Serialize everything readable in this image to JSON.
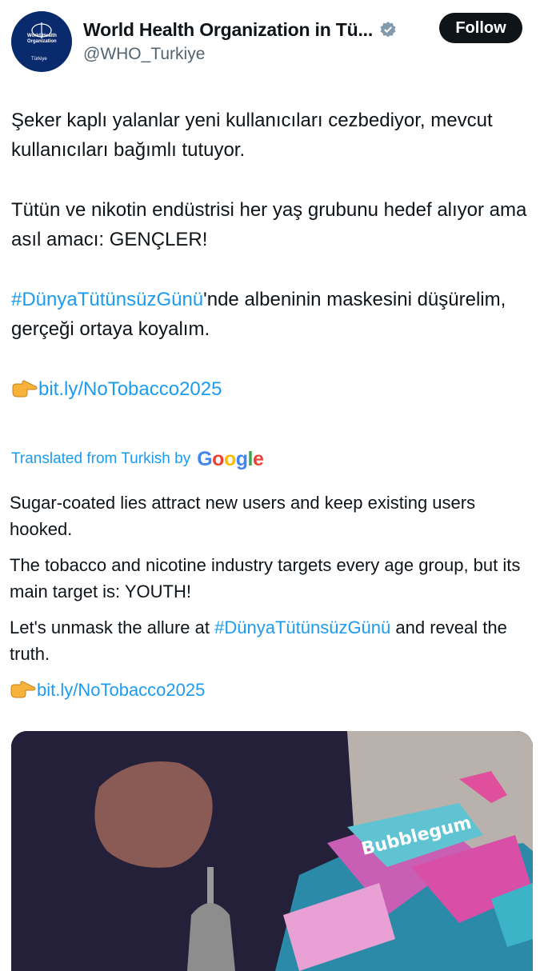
{
  "header": {
    "avatar_text_1": "World Health Organization",
    "avatar_text_2": "Türkiye",
    "display_name": "World Health Organization in Tü...",
    "handle": "@WHO_Turkiye",
    "follow_label": "Follow"
  },
  "tweet": {
    "line1": "Şeker kaplı yalanlar yeni kullanıcıları cezbediyor, mevcut kullanıcıları bağımlı tutuyor.",
    "line2": "Tütün ve nikotin endüstrisi her yaş grubunu hedef alıyor ama asıl amacı: GENÇLER!",
    "hashtag": "#DünyaTütünsüzGünü",
    "line3_rest": "'nde albeninin maskesini düşürelim, gerçeği ortaya koyalım.",
    "link": "bit.ly/NoTobacco2025"
  },
  "translation": {
    "label": "Translated from Turkish by",
    "provider": "Google",
    "p1": "Sugar-coated lies attract new users and keep existing users hooked.",
    "p2": "The tobacco and nicotine industry targets every age group, but its main target is: YOUTH!",
    "p3_before": "Let's unmask the allure at ",
    "p3_hashtag": "#DünyaTütünsüzGünü",
    "p3_after": " and reveal the truth.",
    "link": "bit.ly/NoTobacco2025"
  },
  "media": {
    "package_text": "Bubblegum"
  },
  "colors": {
    "link_blue": "#1d9bf0",
    "secondary_gray": "#536471",
    "text_black": "#0f1419",
    "verified_gray": "#829aab"
  },
  "icons": [
    "verified-badge-icon",
    "pointing-hand-icon"
  ]
}
